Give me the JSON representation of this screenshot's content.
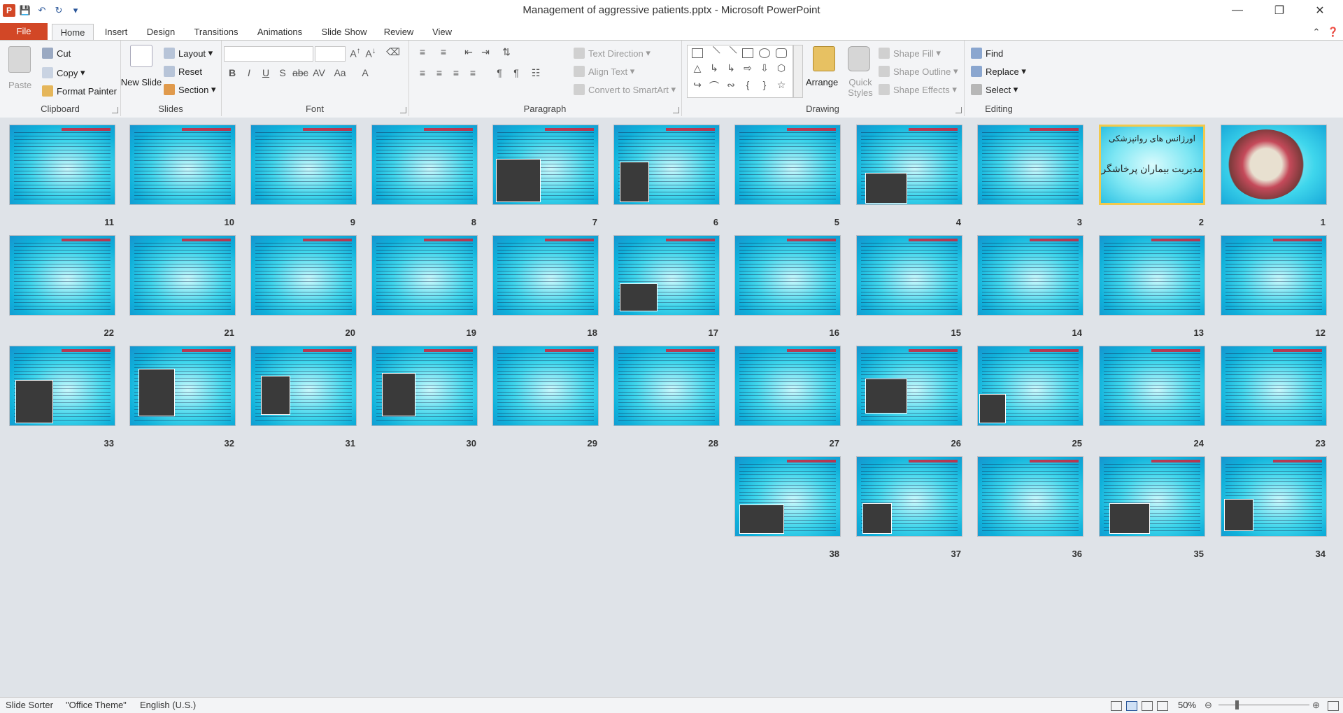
{
  "window": {
    "title": "Management of aggressive patients.pptx  -  Microsoft PowerPoint"
  },
  "tabs": [
    {
      "label": "File"
    },
    {
      "label": "Home"
    },
    {
      "label": "Insert"
    },
    {
      "label": "Design"
    },
    {
      "label": "Transitions"
    },
    {
      "label": "Animations"
    },
    {
      "label": "Slide Show"
    },
    {
      "label": "Review"
    },
    {
      "label": "View"
    }
  ],
  "ribbon": {
    "clipboard": {
      "label": "Clipboard",
      "paste": "Paste",
      "cut": "Cut",
      "copy": "Copy",
      "format_painter": "Format Painter"
    },
    "slides": {
      "label": "Slides",
      "new_slide": "New Slide",
      "layout": "Layout",
      "reset": "Reset",
      "section": "Section"
    },
    "font": {
      "label": "Font",
      "font_name": "",
      "font_size": ""
    },
    "paragraph": {
      "label": "Paragraph",
      "text_direction": "Text Direction",
      "align_text": "Align Text",
      "convert_smartart": "Convert to SmartArt"
    },
    "drawing": {
      "label": "Drawing",
      "arrange": "Arrange",
      "quick_styles": "Quick Styles",
      "shape_fill": "Shape Fill",
      "shape_outline": "Shape Outline",
      "shape_effects": "Shape Effects"
    },
    "editing": {
      "label": "Editing",
      "find": "Find",
      "replace": "Replace",
      "select": "Select"
    }
  },
  "slides": [
    {
      "n": "1"
    },
    {
      "n": "2",
      "line1": "اورژانس های روانپزشکی",
      "line2": "مدیریت بیماران پرخاشگر"
    },
    {
      "n": "3"
    },
    {
      "n": "4"
    },
    {
      "n": "5"
    },
    {
      "n": "6"
    },
    {
      "n": "7"
    },
    {
      "n": "8"
    },
    {
      "n": "9"
    },
    {
      "n": "10"
    },
    {
      "n": "11"
    },
    {
      "n": "12"
    },
    {
      "n": "13"
    },
    {
      "n": "14"
    },
    {
      "n": "15"
    },
    {
      "n": "16"
    },
    {
      "n": "17"
    },
    {
      "n": "18"
    },
    {
      "n": "19"
    },
    {
      "n": "20"
    },
    {
      "n": "21"
    },
    {
      "n": "22"
    },
    {
      "n": "23"
    },
    {
      "n": "24"
    },
    {
      "n": "25"
    },
    {
      "n": "26"
    },
    {
      "n": "27"
    },
    {
      "n": "28"
    },
    {
      "n": "29"
    },
    {
      "n": "30"
    },
    {
      "n": "31"
    },
    {
      "n": "32"
    },
    {
      "n": "33"
    },
    {
      "n": "34"
    },
    {
      "n": "35"
    },
    {
      "n": "36"
    },
    {
      "n": "37"
    },
    {
      "n": "38"
    }
  ],
  "status": {
    "view": "Slide Sorter",
    "theme": "\"Office Theme\"",
    "language": "English (U.S.)",
    "zoom": "50%"
  }
}
